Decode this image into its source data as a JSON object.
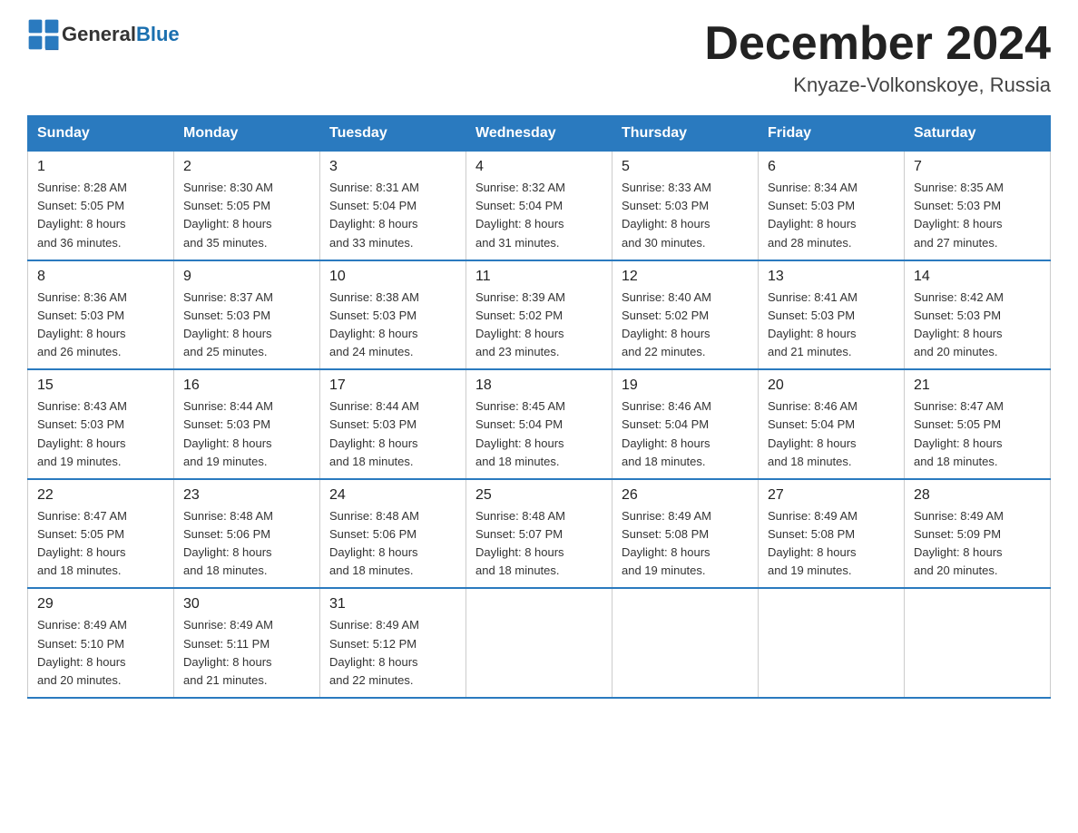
{
  "logo": {
    "general": "General",
    "blue": "Blue"
  },
  "title": "December 2024",
  "location": "Knyaze-Volkonskoye, Russia",
  "headers": [
    "Sunday",
    "Monday",
    "Tuesday",
    "Wednesday",
    "Thursday",
    "Friday",
    "Saturday"
  ],
  "weeks": [
    [
      {
        "day": "1",
        "sunrise": "8:28 AM",
        "sunset": "5:05 PM",
        "daylight": "8 hours and 36 minutes."
      },
      {
        "day": "2",
        "sunrise": "8:30 AM",
        "sunset": "5:05 PM",
        "daylight": "8 hours and 35 minutes."
      },
      {
        "day": "3",
        "sunrise": "8:31 AM",
        "sunset": "5:04 PM",
        "daylight": "8 hours and 33 minutes."
      },
      {
        "day": "4",
        "sunrise": "8:32 AM",
        "sunset": "5:04 PM",
        "daylight": "8 hours and 31 minutes."
      },
      {
        "day": "5",
        "sunrise": "8:33 AM",
        "sunset": "5:03 PM",
        "daylight": "8 hours and 30 minutes."
      },
      {
        "day": "6",
        "sunrise": "8:34 AM",
        "sunset": "5:03 PM",
        "daylight": "8 hours and 28 minutes."
      },
      {
        "day": "7",
        "sunrise": "8:35 AM",
        "sunset": "5:03 PM",
        "daylight": "8 hours and 27 minutes."
      }
    ],
    [
      {
        "day": "8",
        "sunrise": "8:36 AM",
        "sunset": "5:03 PM",
        "daylight": "8 hours and 26 minutes."
      },
      {
        "day": "9",
        "sunrise": "8:37 AM",
        "sunset": "5:03 PM",
        "daylight": "8 hours and 25 minutes."
      },
      {
        "day": "10",
        "sunrise": "8:38 AM",
        "sunset": "5:03 PM",
        "daylight": "8 hours and 24 minutes."
      },
      {
        "day": "11",
        "sunrise": "8:39 AM",
        "sunset": "5:02 PM",
        "daylight": "8 hours and 23 minutes."
      },
      {
        "day": "12",
        "sunrise": "8:40 AM",
        "sunset": "5:02 PM",
        "daylight": "8 hours and 22 minutes."
      },
      {
        "day": "13",
        "sunrise": "8:41 AM",
        "sunset": "5:03 PM",
        "daylight": "8 hours and 21 minutes."
      },
      {
        "day": "14",
        "sunrise": "8:42 AM",
        "sunset": "5:03 PM",
        "daylight": "8 hours and 20 minutes."
      }
    ],
    [
      {
        "day": "15",
        "sunrise": "8:43 AM",
        "sunset": "5:03 PM",
        "daylight": "8 hours and 19 minutes."
      },
      {
        "day": "16",
        "sunrise": "8:44 AM",
        "sunset": "5:03 PM",
        "daylight": "8 hours and 19 minutes."
      },
      {
        "day": "17",
        "sunrise": "8:44 AM",
        "sunset": "5:03 PM",
        "daylight": "8 hours and 18 minutes."
      },
      {
        "day": "18",
        "sunrise": "8:45 AM",
        "sunset": "5:04 PM",
        "daylight": "8 hours and 18 minutes."
      },
      {
        "day": "19",
        "sunrise": "8:46 AM",
        "sunset": "5:04 PM",
        "daylight": "8 hours and 18 minutes."
      },
      {
        "day": "20",
        "sunrise": "8:46 AM",
        "sunset": "5:04 PM",
        "daylight": "8 hours and 18 minutes."
      },
      {
        "day": "21",
        "sunrise": "8:47 AM",
        "sunset": "5:05 PM",
        "daylight": "8 hours and 18 minutes."
      }
    ],
    [
      {
        "day": "22",
        "sunrise": "8:47 AM",
        "sunset": "5:05 PM",
        "daylight": "8 hours and 18 minutes."
      },
      {
        "day": "23",
        "sunrise": "8:48 AM",
        "sunset": "5:06 PM",
        "daylight": "8 hours and 18 minutes."
      },
      {
        "day": "24",
        "sunrise": "8:48 AM",
        "sunset": "5:06 PM",
        "daylight": "8 hours and 18 minutes."
      },
      {
        "day": "25",
        "sunrise": "8:48 AM",
        "sunset": "5:07 PM",
        "daylight": "8 hours and 18 minutes."
      },
      {
        "day": "26",
        "sunrise": "8:49 AM",
        "sunset": "5:08 PM",
        "daylight": "8 hours and 19 minutes."
      },
      {
        "day": "27",
        "sunrise": "8:49 AM",
        "sunset": "5:08 PM",
        "daylight": "8 hours and 19 minutes."
      },
      {
        "day": "28",
        "sunrise": "8:49 AM",
        "sunset": "5:09 PM",
        "daylight": "8 hours and 20 minutes."
      }
    ],
    [
      {
        "day": "29",
        "sunrise": "8:49 AM",
        "sunset": "5:10 PM",
        "daylight": "8 hours and 20 minutes."
      },
      {
        "day": "30",
        "sunrise": "8:49 AM",
        "sunset": "5:11 PM",
        "daylight": "8 hours and 21 minutes."
      },
      {
        "day": "31",
        "sunrise": "8:49 AM",
        "sunset": "5:12 PM",
        "daylight": "8 hours and 22 minutes."
      },
      null,
      null,
      null,
      null
    ]
  ]
}
